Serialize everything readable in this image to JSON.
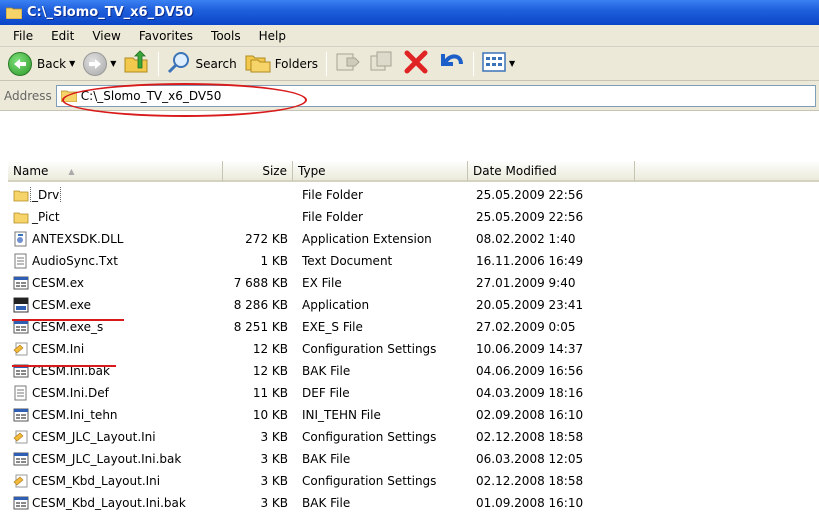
{
  "window": {
    "title": "C:\\_Slomo_TV_x6_DV50"
  },
  "menu": [
    "File",
    "Edit",
    "View",
    "Favorites",
    "Tools",
    "Help"
  ],
  "toolbar": {
    "back_label": "Back",
    "search_label": "Search",
    "folders_label": "Folders"
  },
  "address": {
    "label": "Address",
    "value": "C:\\_Slomo_TV_x6_DV50"
  },
  "columns": {
    "name": "Name",
    "size": "Size",
    "type": "Type",
    "date": "Date Modified"
  },
  "files": [
    {
      "name": "_Drv",
      "size": "",
      "type": "File Folder",
      "date": "25.05.2009 22:56",
      "icon": "folder-icon"
    },
    {
      "name": "_Pict",
      "size": "",
      "type": "File Folder",
      "date": "25.05.2009 22:56",
      "icon": "folder-icon"
    },
    {
      "name": "ANTEXSDK.DLL",
      "size": "272 KB",
      "type": "Application Extension",
      "date": "08.02.2002 1:40",
      "icon": "dll-icon"
    },
    {
      "name": "AudioSync.Txt",
      "size": "1 KB",
      "type": "Text Document",
      "date": "16.11.2006 16:49",
      "icon": "text-file-icon"
    },
    {
      "name": "CESM.ex",
      "size": "7 688 KB",
      "type": "EX File",
      "date": "27.01.2009 9:40",
      "icon": "generic-file-icon"
    },
    {
      "name": "CESM.exe",
      "size": "8 286 KB",
      "type": "Application",
      "date": "20.05.2009 23:41",
      "icon": "app-icon"
    },
    {
      "name": "CESM.exe_s",
      "size": "8 251 KB",
      "type": "EXE_S File",
      "date": "27.02.2009 0:05",
      "icon": "generic-file-icon"
    },
    {
      "name": "CESM.Ini",
      "size": "12 KB",
      "type": "Configuration Settings",
      "date": "10.06.2009 14:37",
      "icon": "config-file-icon"
    },
    {
      "name": "CESM.Ini.bak",
      "size": "12 KB",
      "type": "BAK File",
      "date": "04.06.2009 16:56",
      "icon": "generic-file-icon"
    },
    {
      "name": "CESM.Ini.Def",
      "size": "11 KB",
      "type": "DEF File",
      "date": "04.03.2009 18:16",
      "icon": "text-file-icon"
    },
    {
      "name": "CESM.Ini_tehn",
      "size": "10 KB",
      "type": "INI_TEHN File",
      "date": "02.09.2008 16:10",
      "icon": "generic-file-icon"
    },
    {
      "name": "CESM_JLC_Layout.Ini",
      "size": "3 KB",
      "type": "Configuration Settings",
      "date": "02.12.2008 18:58",
      "icon": "config-file-icon"
    },
    {
      "name": "CESM_JLC_Layout.Ini.bak",
      "size": "3 KB",
      "type": "BAK File",
      "date": "06.03.2008 12:05",
      "icon": "generic-file-icon"
    },
    {
      "name": "CESM_Kbd_Layout.Ini",
      "size": "3 KB",
      "type": "Configuration Settings",
      "date": "02.12.2008 18:58",
      "icon": "config-file-icon"
    },
    {
      "name": "CESM_Kbd_Layout.Ini.bak",
      "size": "3 KB",
      "type": "BAK File",
      "date": "01.09.2008 16:10",
      "icon": "generic-file-icon"
    }
  ],
  "colors": {
    "annotation_red": "#d81a1a",
    "title_blue": "#0a46c8"
  }
}
